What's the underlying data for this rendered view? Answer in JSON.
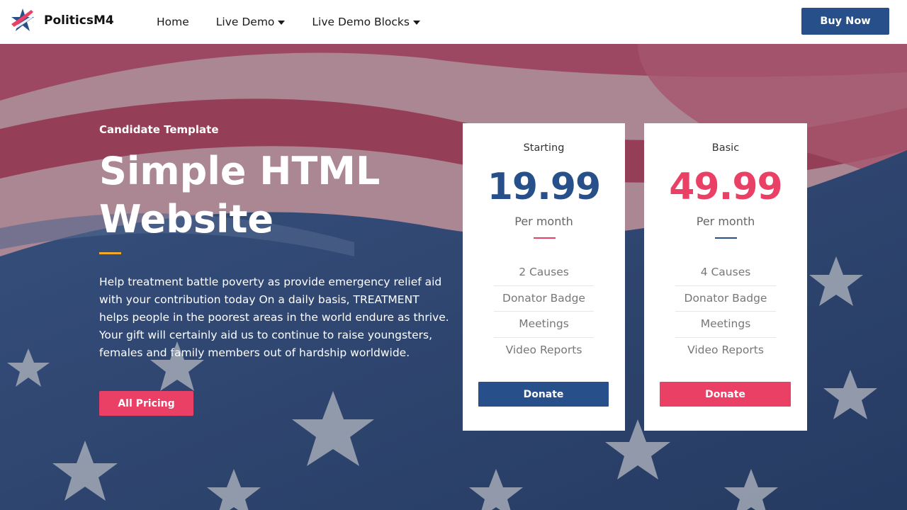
{
  "brand": {
    "name": "PoliticsM4",
    "logo_icon": "star-flag-logo-icon"
  },
  "nav": {
    "items": [
      {
        "label": "Home",
        "dropdown": false
      },
      {
        "label": "Live Demo",
        "dropdown": true
      },
      {
        "label": "Live Demo Blocks",
        "dropdown": true
      }
    ],
    "cta_label": "Buy Now"
  },
  "hero": {
    "eyebrow": "Candidate Template",
    "headline": "Simple HTML Website",
    "text": "Help treatment battle poverty as provide emergency relief aid with your contribution today On a daily basis, TREATMENT helps people in the poorest areas in the world endure as thrive. Your gift will certainly aid us to continue to raise youngsters, females and family members out of hardship worldwide.",
    "button_label": "All Pricing"
  },
  "pricing": [
    {
      "plan": "Starting",
      "price": "19.99",
      "period": "Per month",
      "features": [
        "2 Causes",
        "Donator Badge",
        "Meetings",
        "Video Reports"
      ],
      "button_label": "Donate",
      "price_color": "#27508a",
      "divider_color": "#ea4066",
      "button_color": "#27508a"
    },
    {
      "plan": "Basic",
      "price": "49.99",
      "period": "Per month",
      "features": [
        "4 Causes",
        "Donator Badge",
        "Meetings",
        "Video Reports"
      ],
      "button_label": "Donate",
      "price_color": "#ea4066",
      "divider_color": "#27508a",
      "button_color": "#ea4066"
    }
  ],
  "colors": {
    "primary_blue": "#27508a",
    "accent_pink": "#ea4066",
    "accent_orange": "#f3a72b"
  }
}
